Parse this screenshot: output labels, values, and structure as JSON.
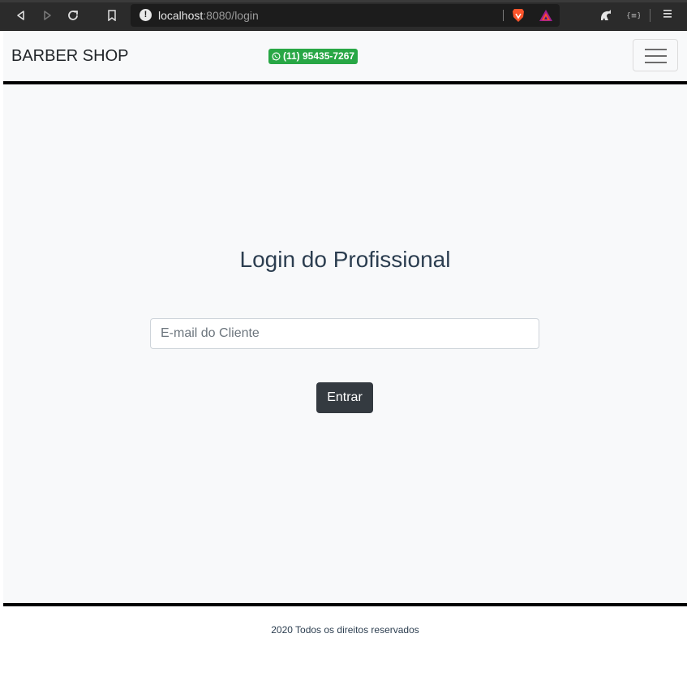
{
  "browser": {
    "url_host": "localhost",
    "url_path": ":8080/login",
    "icons": [
      "back-icon",
      "forward-icon",
      "reload-icon",
      "bookmark-icon",
      "site-info-icon",
      "brave-shields-icon",
      "brave-rewards-icon",
      "extension-icon",
      "wallet-icon",
      "menu-icon"
    ]
  },
  "navbar": {
    "brand": "BARBER SHOP",
    "phone": "(11) 95435-7267",
    "phone_color": "#28a745"
  },
  "login": {
    "title": "Login do Profissional",
    "email_placeholder": "E-mail do Cliente",
    "submit_label": "Entrar"
  },
  "footer": {
    "text": "2020 Todos os direitos reservados"
  },
  "colors": {
    "page_background": "#f8f9fa",
    "button": "#343a40",
    "rule": "#000000"
  }
}
